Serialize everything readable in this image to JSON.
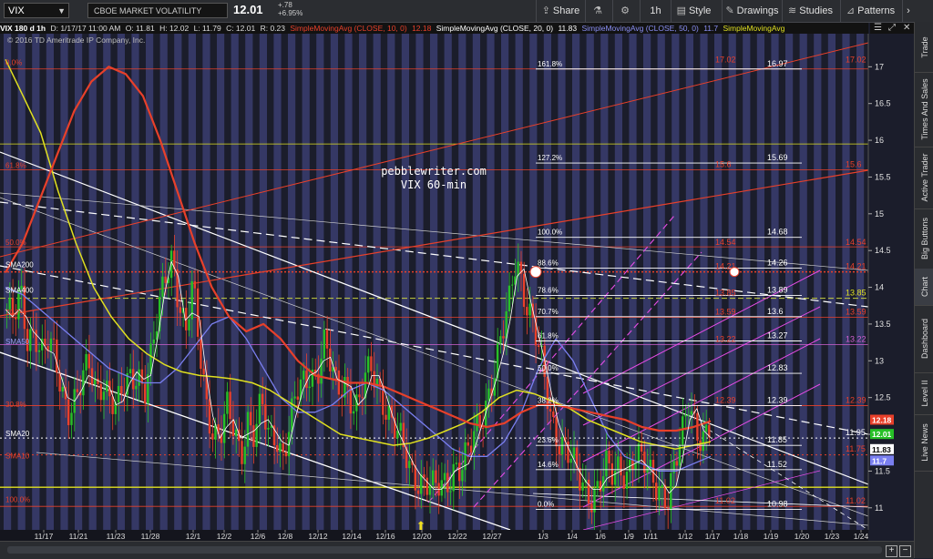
{
  "toolbar": {
    "symbol": "VIX",
    "description": "CBOE MARKET VOLATILITY INDEX",
    "last": "12.01",
    "change": "+.78",
    "change_pct": "+6.95%",
    "share": "Share",
    "interval": "1h",
    "style": "Style",
    "drawings": "Drawings",
    "studies": "Studies",
    "patterns": "Patterns"
  },
  "infobar": {
    "symbol_period": "VIX 180 d 1h",
    "date": "D: 1/17/17 11:00 AM",
    "open": "O: 11.81",
    "high": "H: 12.02",
    "low": "L: 11.79",
    "close": "C: 12.01",
    "range": "R: 0.23",
    "sma10": "SimpleMovingAvg (CLOSE, 10, 0)",
    "sma10_val": "12.18",
    "sma20": "SimpleMovingAvg (CLOSE, 20, 0)",
    "sma20_val": "11.83",
    "sma50": "SimpleMovingAvg (CLOSE, 50, 0)",
    "sma50_val": "11.7",
    "sma200": "SimpleMovingAvg"
  },
  "copyright": "© 2016 TD Ameritrade IP Company, Inc.",
  "watermark": {
    "line1": "pebblewriter.com",
    "line2": "VIX 60-min"
  },
  "right_tabs": [
    "Trade",
    "Times And Sales",
    "Active Trader",
    "Big Buttons",
    "Chart",
    "Dashboard",
    "Level II",
    "Live News"
  ],
  "colors": {
    "background": "#1b1d2b",
    "band": "#4a4f96",
    "sma10": "#e8402a",
    "sma20": "#ffffff",
    "sma50": "#7a7ff0",
    "sma200": "#e0e020",
    "fib": "#ffffff",
    "fib_red": "#e8402a",
    "channel": "#e64ce6",
    "up": "#27c027",
    "down": "#e8402a"
  },
  "chart_data": {
    "type": "candlestick",
    "title": "VIX 180 d 1h",
    "ylim": [
      10.7,
      17.45
    ],
    "y_ticks": [
      11,
      11.5,
      12,
      12.5,
      13,
      13.5,
      14,
      14.5,
      15,
      15.5,
      16,
      16.5,
      17
    ],
    "x_labels": [
      "11/17",
      "11/21",
      "11/23",
      "11/28",
      "12/1",
      "12/2",
      "12/6",
      "12/8",
      "12/12",
      "12/14",
      "12/16",
      "12/20",
      "12/22",
      "12/27",
      "1/3",
      "1/4",
      "1/6",
      "1/9",
      "1/11",
      "1/12",
      "1/17",
      "1/18",
      "1/19",
      "1/20",
      "1/23",
      "1/24"
    ],
    "close_series": [
      13.7,
      13.5,
      13.9,
      13.3,
      13.5,
      13.1,
      13.2,
      13.0,
      12.6,
      12.4,
      12.5,
      12.7,
      12.9,
      12.6,
      12.8,
      12.5,
      12.3,
      12.6,
      12.8,
      12.9,
      12.6,
      13.0,
      13.6,
      14.2,
      14.5,
      13.8,
      13.3,
      14.0,
      13.2,
      12.5,
      12.0,
      11.9,
      12.3,
      12.1,
      11.8,
      12.2,
      11.9,
      12.4,
      12.0,
      12.1,
      11.7,
      12.0,
      12.5,
      12.7,
      12.9,
      12.8,
      13.2,
      12.9,
      12.6,
      12.8,
      12.5,
      12.3,
      12.7,
      12.9,
      12.7,
      12.4,
      12.1,
      11.9,
      11.7,
      11.5,
      11.4,
      11.3,
      11.2,
      11.3,
      11.4,
      11.6,
      11.5,
      11.7,
      12.0,
      12.3,
      12.6,
      12.9,
      13.3,
      13.8,
      14.5,
      14.0,
      13.6,
      13.2,
      12.8,
      12.3,
      12.0,
      11.8,
      11.6,
      11.4,
      11.3,
      11.2,
      11.3,
      11.5,
      11.4,
      11.6,
      11.5,
      11.7,
      11.6,
      11.5,
      11.4,
      11.3,
      11.1,
      11.5,
      11.9,
      12.5,
      12.2,
      11.9,
      12.01
    ],
    "sma200": [
      17.1,
      16.6,
      16.1,
      15.3,
      14.6,
      14.0,
      13.6,
      13.3,
      13.1,
      12.95,
      12.85,
      12.8,
      12.78,
      12.75,
      12.7,
      12.6,
      12.45,
      12.3,
      12.15,
      12.0,
      11.95,
      11.9,
      11.85,
      11.88,
      11.95,
      12.05,
      12.15,
      12.3,
      12.5,
      12.6,
      12.55,
      12.45,
      12.35,
      12.2,
      12.1,
      12.0,
      11.9,
      11.85,
      11.8,
      11.85,
      11.9
    ],
    "sma50": [
      14.0,
      13.9,
      13.7,
      13.5,
      13.3,
      13.1,
      12.9,
      12.8,
      12.7,
      12.7,
      12.9,
      13.2,
      13.5,
      13.6,
      13.3,
      12.9,
      12.5,
      12.3,
      12.3,
      12.4,
      12.6,
      12.7,
      12.6,
      12.4,
      12.2,
      12.0,
      11.8,
      11.7,
      11.7,
      11.9,
      12.3,
      12.9,
      13.3,
      13.0,
      12.5,
      12.0,
      11.7,
      11.6,
      11.5,
      11.5,
      11.6,
      11.7
    ],
    "sma10": [
      14.2,
      14.6,
      15.2,
      15.8,
      16.4,
      16.8,
      17.0,
      16.9,
      16.6,
      16.0,
      15.3,
      14.6,
      14.0,
      13.6,
      13.4,
      13.5,
      13.3,
      13.0,
      12.8,
      12.75,
      12.7,
      12.7,
      12.65,
      12.55,
      12.45,
      12.35,
      12.25,
      12.15,
      12.1,
      12.15,
      12.3,
      12.4,
      12.4,
      12.35,
      12.3,
      12.25,
      12.2,
      12.1,
      12.05,
      12.05,
      12.1,
      12.18
    ],
    "fib_levels": [
      {
        "pct": "161.8%",
        "value": "16.97",
        "marker": "17.02"
      },
      {
        "pct": "127.2%",
        "value": "15.69",
        "marker": "15.6"
      },
      {
        "pct": "100.0%",
        "value": "14.68",
        "marker": "14.54"
      },
      {
        "pct": "88.6%",
        "value": "14.26",
        "marker": "14.21"
      },
      {
        "pct": "78.6%",
        "value": "13.89",
        "marker": "13.85"
      },
      {
        "pct": "70.7%",
        "value": "13.6",
        "marker": "13.59"
      },
      {
        "pct": "61.8%",
        "value": "13.27",
        "marker": "13.22"
      },
      {
        "pct": "50.0%",
        "value": "12.83",
        "marker": ""
      },
      {
        "pct": "38.2%",
        "value": "12.39",
        "marker": "12.39"
      },
      {
        "pct": "23.6%",
        "value": "11.85",
        "marker": ""
      },
      {
        "pct": "14.6%",
        "value": "11.52",
        "marker": ""
      },
      {
        "pct": "0.0%",
        "value": "10.98",
        "marker": "11.02"
      }
    ],
    "left_labels": [
      {
        "text": "0.0%",
        "value": 17.0
      },
      {
        "text": "61.8%",
        "value": 15.6
      },
      {
        "text": "SMA200",
        "value": 14.25
      },
      {
        "text": "SMA400",
        "value": 13.9
      },
      {
        "text": "50.0%",
        "value": 14.55
      },
      {
        "text": "70.7%",
        "value": 13.6
      },
      {
        "text": "SMA50",
        "value": 13.2
      },
      {
        "text": "30.8%",
        "value": 12.35
      },
      {
        "text": "SMA20",
        "value": 11.95
      },
      {
        "text": "SMA10",
        "value": 11.65
      },
      {
        "text": "100.0%",
        "value": 11.05
      }
    ],
    "price_tags": [
      {
        "value": "12.18",
        "color": "#e8402a"
      },
      {
        "value": "12.01",
        "color": "#27c027"
      },
      {
        "value": "11.83",
        "color": "#ffffff"
      },
      {
        "value": "11.7",
        "color": "#7a7ff0"
      }
    ],
    "extra_right_labels": [
      {
        "text": "11.95",
        "value": 11.95,
        "color": "#ffffff"
      },
      {
        "text": "11.75",
        "value": 11.73,
        "color": "#e8402a"
      }
    ]
  }
}
